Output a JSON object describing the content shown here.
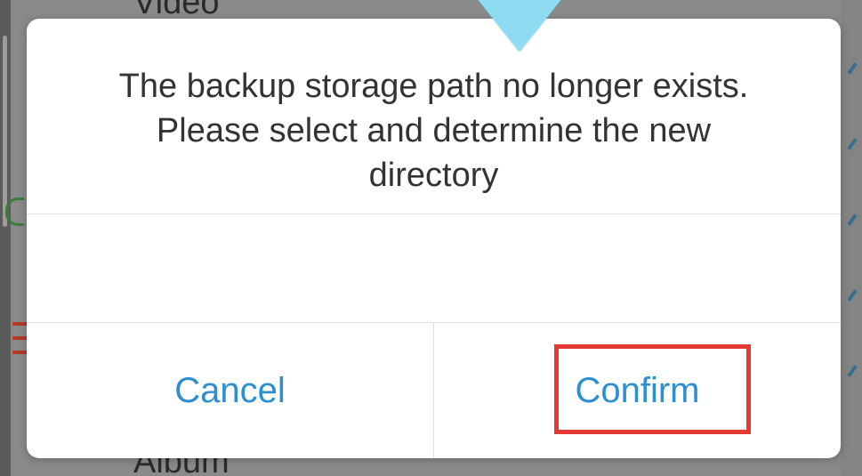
{
  "background": {
    "top_item_label": "Video",
    "bottom_item_label": "Album"
  },
  "dialog": {
    "message_line1": "The backup storage path no longer exists.",
    "message_line2": "Please select and determine the new",
    "message_line3": "directory",
    "cancel_label": "Cancel",
    "confirm_label": "Confirm"
  },
  "colors": {
    "button_text": "#2b8fd1",
    "message_text": "#333333",
    "highlight": "#e53935",
    "tooltip": "#8fdcf2"
  }
}
